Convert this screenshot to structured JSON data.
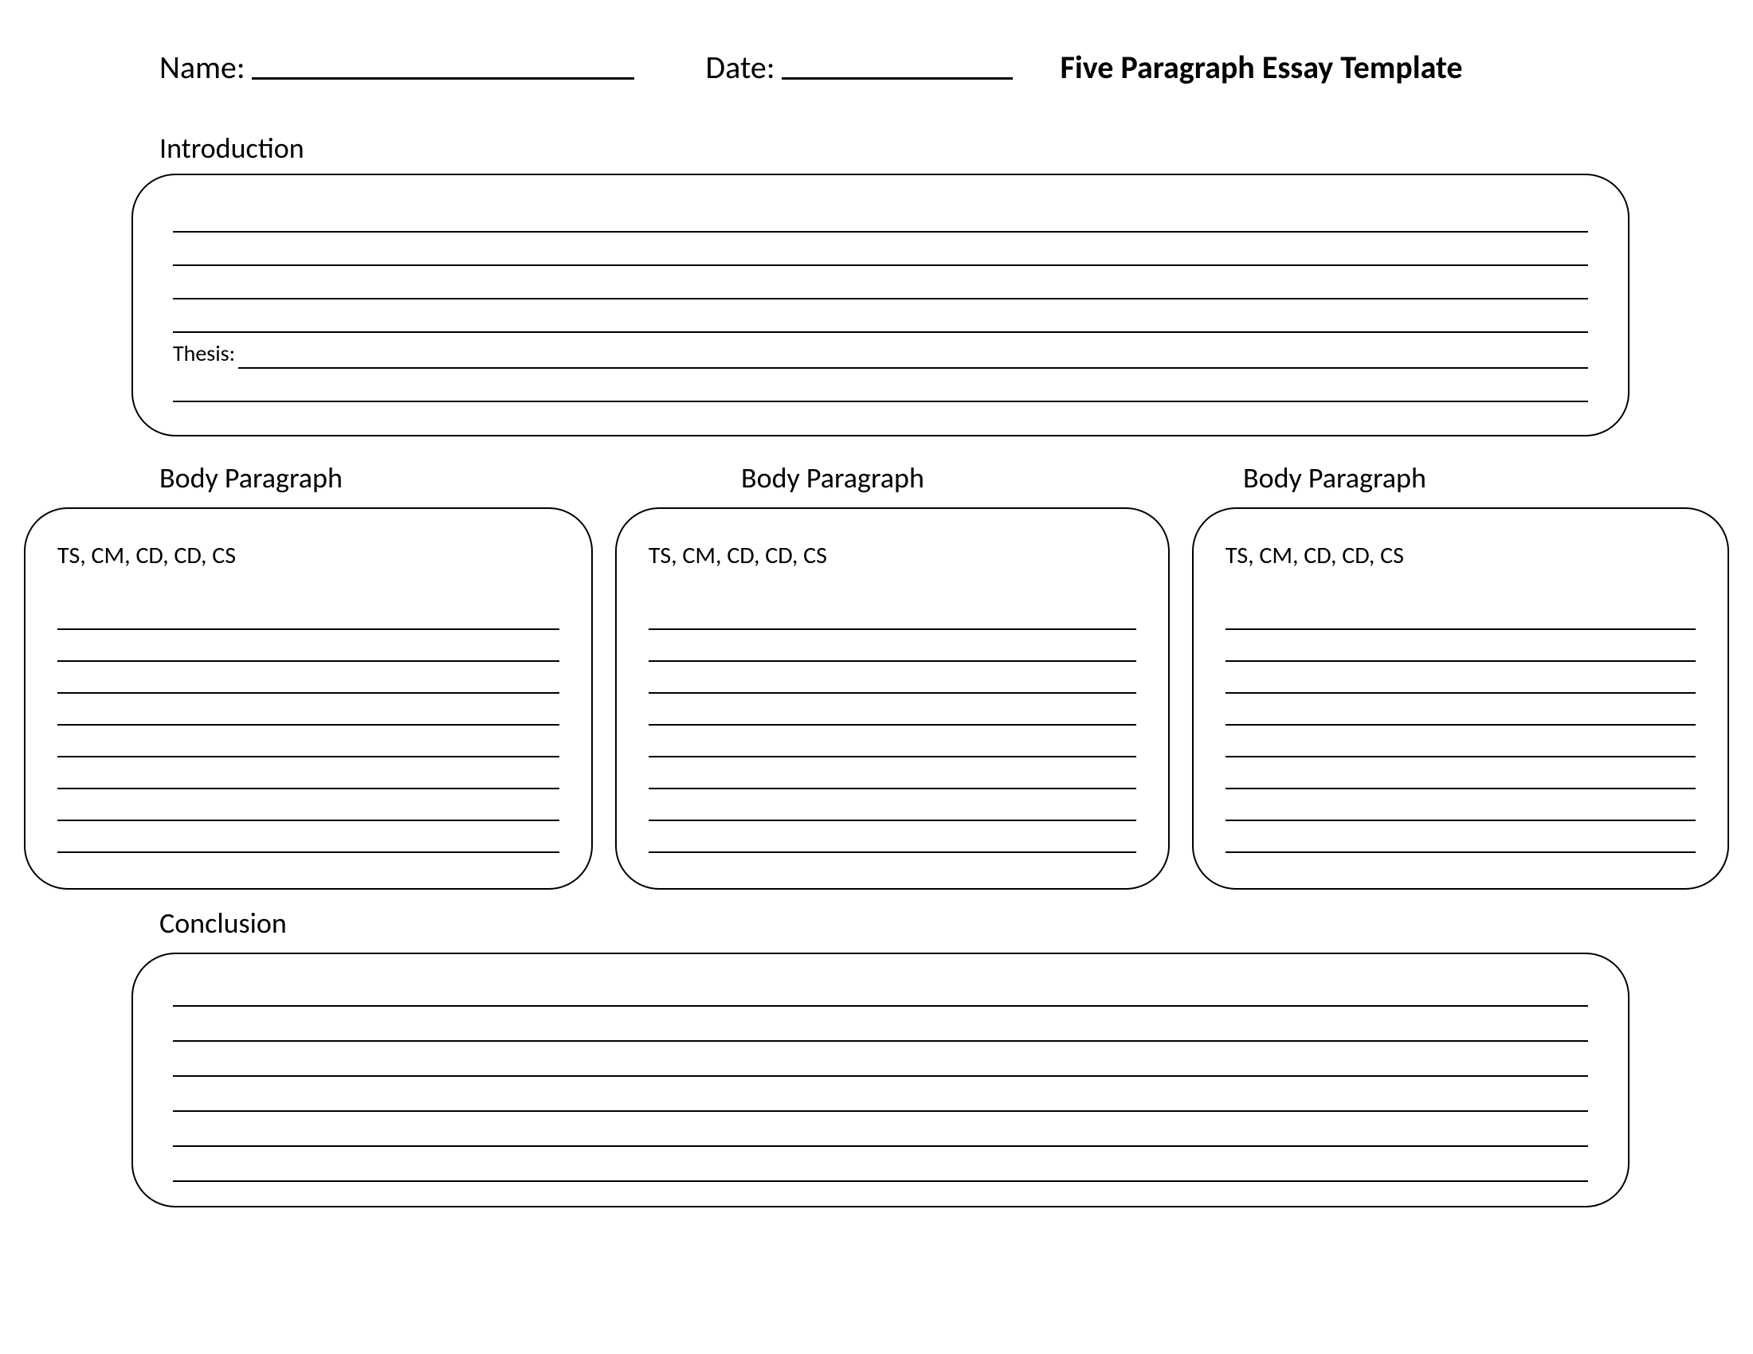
{
  "header": {
    "name_label": "Name:",
    "date_label": "Date:",
    "title": "Five Paragraph Essay Template"
  },
  "intro": {
    "label": "Introduction",
    "thesis_label": "Thesis:"
  },
  "body": {
    "label1": "Body Paragraph",
    "label2": "Body Paragraph",
    "label3": "Body Paragraph",
    "ts_label": "TS, CM, CD, CD, CS"
  },
  "conclusion": {
    "label": "Conclusion"
  }
}
